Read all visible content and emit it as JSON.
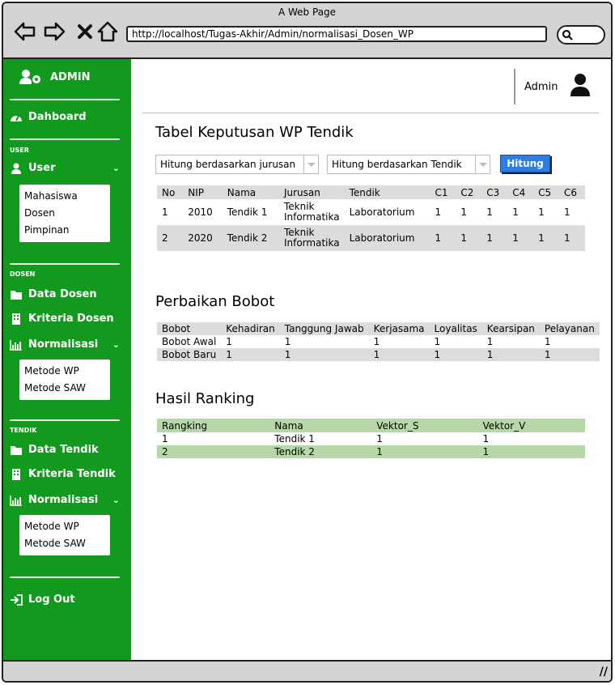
{
  "browser": {
    "title": "A Web Page",
    "url": "http://localhost/Tugas-Akhir/Admin/normalisasi_Dosen_WP"
  },
  "sidebar": {
    "header": "ADMIN",
    "dashboard": "Dahboard",
    "sections": {
      "user": "USER",
      "dosen": "DOSEN",
      "tendik": "TENDIK"
    },
    "user_menu": {
      "label": "User",
      "sub": [
        "Mahasiswa",
        "Dosen",
        "Pimpinan"
      ]
    },
    "dosen_items": {
      "data": "Data Dosen",
      "kriteria": "Kriteria Dosen",
      "normalisasi": "Normalisasi",
      "sub": [
        "Metode WP",
        "Metode SAW"
      ]
    },
    "tendik_items": {
      "data": "Data Tendik",
      "kriteria": "Kriteria Tendik",
      "normalisasi": "Normalisasi",
      "sub": [
        "Metode WP",
        "Metode SAW"
      ]
    },
    "logout": "Log Out"
  },
  "topbar": {
    "user": "Admin"
  },
  "main": {
    "title": "Tabel Keputusan WP Tendik",
    "select_jurusan": "Hitung berdasarkan jurusan",
    "select_tendik": "Hitung berdasarkan Tendik",
    "hitung_button": "Hitung",
    "decision_table": {
      "headers": [
        "No",
        "NIP",
        "Nama",
        "Jurusan",
        "Tendik",
        "C1",
        "C2",
        "C3",
        "C4",
        "C5",
        "C6"
      ],
      "rows": [
        [
          "1",
          "2010",
          "Tendik 1",
          "Teknik Informatika",
          "Laboratorium",
          "1",
          "1",
          "1",
          "1",
          "1",
          "1"
        ],
        [
          "2",
          "2020",
          "Tendik 2",
          "Teknik Informatika",
          "Laboratorium",
          "1",
          "1",
          "1",
          "1",
          "1",
          "1"
        ]
      ]
    },
    "bobot_title": "Perbaikan Bobot",
    "bobot_table": {
      "headers": [
        "Bobot",
        "Kehadiran",
        "Tanggung Jawab",
        "Kerjasama",
        "Loyalitas",
        "Kearsipan",
        "Pelayanan"
      ],
      "rows": [
        [
          "Bobot Awal",
          "1",
          "1",
          "1",
          "1",
          "1",
          "1"
        ],
        [
          "Bobot Baru",
          "1",
          "1",
          "1",
          "1",
          "1",
          "1"
        ]
      ]
    },
    "ranking_title": "Hasil Ranking",
    "ranking_table": {
      "headers": [
        "Rangking",
        "Nama",
        "Vektor_S",
        "Vektor_V"
      ],
      "rows": [
        [
          "1",
          "Tendik 1",
          "1",
          "1"
        ],
        [
          "2",
          "Tendik 2",
          "1",
          "1"
        ]
      ]
    }
  },
  "colors": {
    "sidebar": "#119a1d",
    "button": "#2f7de1",
    "ranking_row": "#b8d7a8"
  }
}
